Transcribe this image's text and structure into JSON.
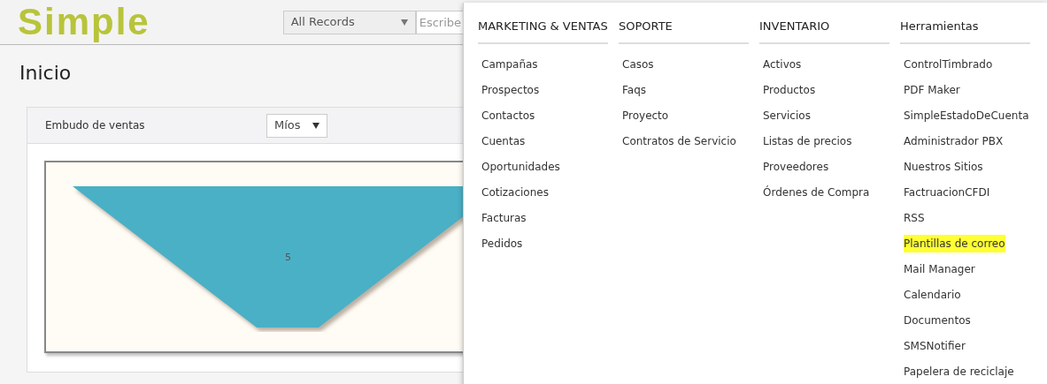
{
  "header": {
    "logo": "Simple",
    "search_scope": "All Records",
    "search": {
      "placeholder": "Escribe"
    }
  },
  "page_title": "Inicio",
  "widget": {
    "title": "Embudo de ventas",
    "filter": "Míos",
    "funnel_label": "5"
  },
  "menu": {
    "columns": [
      {
        "title": "MARKETING & VENTAS",
        "items": [
          {
            "label": "Campañas",
            "highlighted": false
          },
          {
            "label": "Prospectos",
            "highlighted": false
          },
          {
            "label": "Contactos",
            "highlighted": false
          },
          {
            "label": "Cuentas",
            "highlighted": false
          },
          {
            "label": "Oportunidades",
            "highlighted": false
          },
          {
            "label": "Cotizaciones",
            "highlighted": false
          },
          {
            "label": "Facturas",
            "highlighted": false
          },
          {
            "label": "Pedidos",
            "highlighted": false
          }
        ]
      },
      {
        "title": "SOPORTE",
        "items": [
          {
            "label": "Casos",
            "highlighted": false
          },
          {
            "label": "Faqs",
            "highlighted": false
          },
          {
            "label": "Proyecto",
            "highlighted": false
          },
          {
            "label": "Contratos de Servicio",
            "highlighted": false
          }
        ]
      },
      {
        "title": "INVENTARIO",
        "items": [
          {
            "label": "Activos",
            "highlighted": false
          },
          {
            "label": "Productos",
            "highlighted": false
          },
          {
            "label": "Servicios",
            "highlighted": false
          },
          {
            "label": "Listas de precios",
            "highlighted": false
          },
          {
            "label": "Proveedores",
            "highlighted": false
          },
          {
            "label": "Órdenes de Compra",
            "highlighted": false
          }
        ]
      },
      {
        "title": "Herramientas",
        "items": [
          {
            "label": "ControlTimbrado",
            "highlighted": false
          },
          {
            "label": "PDF Maker",
            "highlighted": false
          },
          {
            "label": "SimpleEstadoDeCuenta",
            "highlighted": false
          },
          {
            "label": "Administrador PBX",
            "highlighted": false
          },
          {
            "label": "Nuestros Sitios",
            "highlighted": false
          },
          {
            "label": "FactruacionCFDI",
            "highlighted": false
          },
          {
            "label": "RSS",
            "highlighted": false
          },
          {
            "label": "Plantillas de correo",
            "highlighted": true
          },
          {
            "label": "Mail Manager",
            "highlighted": false
          },
          {
            "label": "Calendario",
            "highlighted": false
          },
          {
            "label": "Documentos",
            "highlighted": false
          },
          {
            "label": "SMSNotifier",
            "highlighted": false
          },
          {
            "label": "Papelera de reciclaje",
            "highlighted": false
          }
        ]
      }
    ]
  }
}
